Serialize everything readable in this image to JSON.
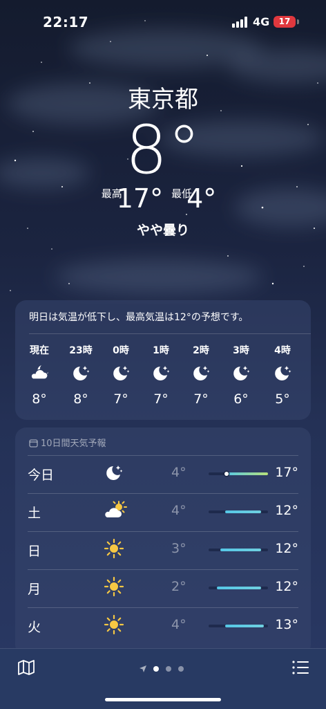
{
  "status_bar": {
    "time": "22:17",
    "network": "4G",
    "battery": "17"
  },
  "header": {
    "city": "東京都",
    "temperature": "8°",
    "high_label": "最高",
    "high": "17°",
    "low_label": "最低",
    "low": "4°",
    "condition": "やや曇り"
  },
  "hourly": {
    "summary": "明日は気温が低下し、最高気温は12°の予想です。",
    "items": [
      {
        "label": "現在",
        "icon": "cloud-moon-icon",
        "temp": "8°"
      },
      {
        "label": "23時",
        "icon": "moon-stars-icon",
        "temp": "8°"
      },
      {
        "label": "0時",
        "icon": "moon-stars-icon",
        "temp": "7°"
      },
      {
        "label": "1時",
        "icon": "moon-stars-icon",
        "temp": "7°"
      },
      {
        "label": "2時",
        "icon": "moon-stars-icon",
        "temp": "7°"
      },
      {
        "label": "3時",
        "icon": "moon-stars-icon",
        "temp": "6°"
      },
      {
        "label": "4時",
        "icon": "moon-stars-icon",
        "temp": "5°"
      }
    ]
  },
  "daily": {
    "title": "10日間天気予報",
    "items": [
      {
        "day": "今日",
        "icon": "moon-stars-icon",
        "low": "4°",
        "high": "17°",
        "range_start": 0.28,
        "range_end": 1.0,
        "current": 0.3
      },
      {
        "day": "土",
        "icon": "sun-cloud-icon",
        "low": "4°",
        "high": "12°",
        "range_start": 0.28,
        "range_end": 0.88
      },
      {
        "day": "日",
        "icon": "sun-icon",
        "low": "3°",
        "high": "12°",
        "range_start": 0.2,
        "range_end": 0.88
      },
      {
        "day": "月",
        "icon": "sun-icon",
        "low": "2°",
        "high": "12°",
        "range_start": 0.14,
        "range_end": 0.88
      },
      {
        "day": "火",
        "icon": "sun-icon",
        "low": "4°",
        "high": "13°",
        "range_start": 0.28,
        "range_end": 0.93
      }
    ]
  },
  "colors": {
    "accent_bar": "#55c7e6",
    "warm_bar": "#b7e07a",
    "sun": "#f7c843",
    "battery": "#e0383e"
  }
}
